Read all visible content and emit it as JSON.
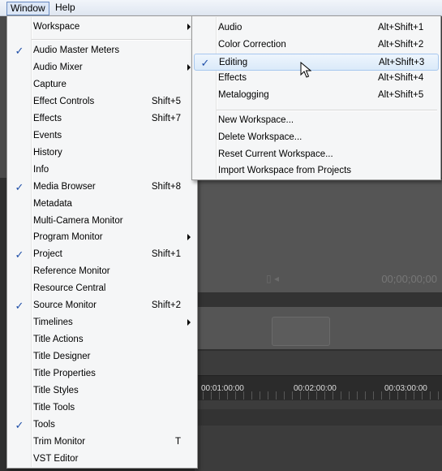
{
  "menubar": {
    "window_label": "Window",
    "help_label": "Help"
  },
  "window_menu": {
    "workspace_label": "Workspace",
    "items": [
      {
        "label": "Audio Master Meters",
        "checked": true,
        "shortcut": ""
      },
      {
        "label": "Audio Mixer",
        "checked": false,
        "shortcut": "",
        "submenu": true
      },
      {
        "label": "Capture",
        "checked": false,
        "shortcut": ""
      },
      {
        "label": "Effect Controls",
        "checked": false,
        "shortcut": "Shift+5"
      },
      {
        "label": "Effects",
        "checked": false,
        "shortcut": "Shift+7"
      },
      {
        "label": "Events",
        "checked": false,
        "shortcut": ""
      },
      {
        "label": "History",
        "checked": false,
        "shortcut": ""
      },
      {
        "label": "Info",
        "checked": false,
        "shortcut": ""
      },
      {
        "label": "Media Browser",
        "checked": true,
        "shortcut": "Shift+8"
      },
      {
        "label": "Metadata",
        "checked": false,
        "shortcut": ""
      },
      {
        "label": "Multi-Camera Monitor",
        "checked": false,
        "shortcut": ""
      },
      {
        "label": "Program Monitor",
        "checked": false,
        "shortcut": "",
        "submenu": true
      },
      {
        "label": "Project",
        "checked": true,
        "shortcut": "Shift+1"
      },
      {
        "label": "Reference Monitor",
        "checked": false,
        "shortcut": ""
      },
      {
        "label": "Resource Central",
        "checked": false,
        "shortcut": ""
      },
      {
        "label": "Source Monitor",
        "checked": true,
        "shortcut": "Shift+2"
      },
      {
        "label": "Timelines",
        "checked": false,
        "shortcut": "",
        "submenu": true
      },
      {
        "label": "Title Actions",
        "checked": false,
        "shortcut": ""
      },
      {
        "label": "Title Designer",
        "checked": false,
        "shortcut": ""
      },
      {
        "label": "Title Properties",
        "checked": false,
        "shortcut": ""
      },
      {
        "label": "Title Styles",
        "checked": false,
        "shortcut": ""
      },
      {
        "label": "Title Tools",
        "checked": false,
        "shortcut": ""
      },
      {
        "label": "Tools",
        "checked": true,
        "shortcut": ""
      },
      {
        "label": "Trim Monitor",
        "checked": false,
        "shortcut": "T"
      },
      {
        "label": "VST Editor",
        "checked": false,
        "shortcut": ""
      }
    ]
  },
  "workspace_submenu": {
    "workspaces": [
      {
        "label": "Audio",
        "checked": false,
        "shortcut": "Alt+Shift+1"
      },
      {
        "label": "Color Correction",
        "checked": false,
        "shortcut": "Alt+Shift+2"
      },
      {
        "label": "Editing",
        "checked": true,
        "shortcut": "Alt+Shift+3",
        "highlighted": true
      },
      {
        "label": "Effects",
        "checked": false,
        "shortcut": "Alt+Shift+4"
      },
      {
        "label": "Metalogging",
        "checked": false,
        "shortcut": "Alt+Shift+5"
      }
    ],
    "actions": [
      "New Workspace...",
      "Delete Workspace...",
      "Reset Current Workspace...",
      "Import Workspace from Projects"
    ]
  },
  "background": {
    "timecode": "00;00;00;00",
    "ruler_labels": [
      "00:01:00:00",
      "00:02:00:00",
      "00:03:00:00"
    ]
  },
  "icons": {
    "check": "checkmark-icon",
    "submenu": "chevron-right-icon",
    "cursor": "mouse-pointer-icon"
  }
}
